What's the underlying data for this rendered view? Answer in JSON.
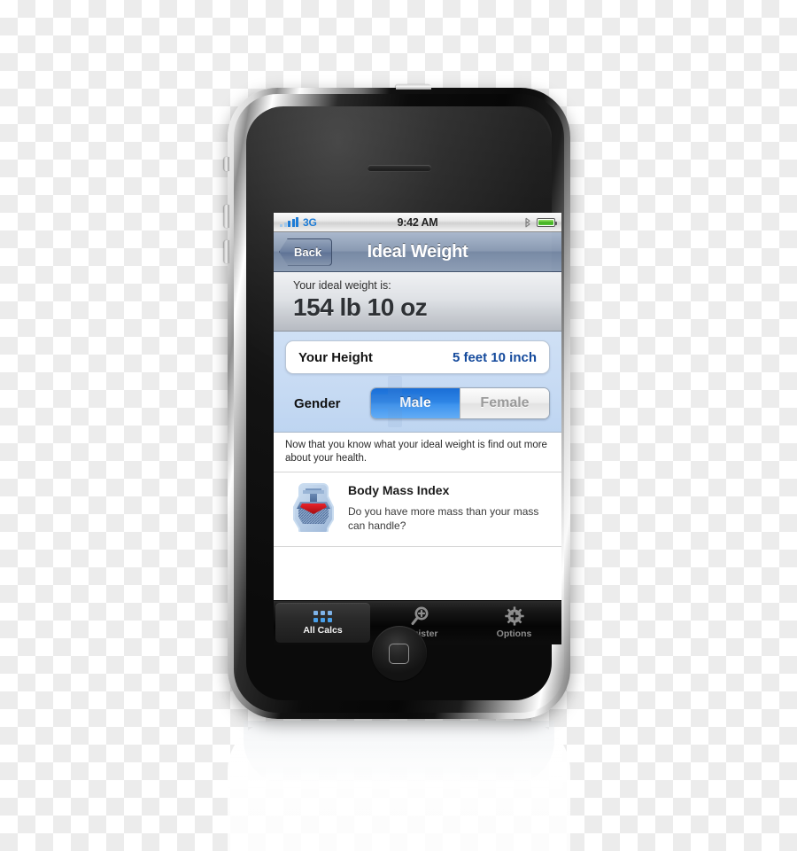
{
  "device": {
    "name": "iPhone 3G",
    "earpiece_icon": "speaker-grille-icon",
    "home_button_icon": "home-square-icon",
    "buttons": {
      "silent_switch": "silent-switch",
      "volume_up": "volume-up-button",
      "volume_down": "volume-down-button",
      "power": "power-button"
    }
  },
  "statusbar": {
    "signal_icon": "signal-bars-icon",
    "carrier": "3G",
    "time": "9:42 AM",
    "bluetooth_icon": "bluetooth-icon",
    "bluetooth_glyph": "�ILLEGAL",
    "battery_icon": "battery-icon"
  },
  "navbar": {
    "back_label": "Back",
    "title": "Ideal Weight"
  },
  "result": {
    "label": "Your ideal weight is:",
    "value": "154 lb 10 oz"
  },
  "inputs": {
    "height": {
      "label": "Your Height",
      "value": "5 feet 10 inch"
    },
    "gender": {
      "label": "Gender",
      "options": [
        "Male",
        "Female"
      ],
      "selected": "Male"
    }
  },
  "blurb": "Now that you know what your ideal weight is find out more about your health.",
  "promo": {
    "icon": "anvil-icon",
    "title": "Body Mass Index",
    "description": "Do you have more mass than your mass can handle?"
  },
  "tabbar": {
    "items": [
      {
        "label": "All Calcs",
        "icon": "grid-icon",
        "selected": true
      },
      {
        "label": "Register",
        "icon": "magnifier-plus-icon",
        "selected": false
      },
      {
        "label": "Options",
        "icon": "gear-plus-icon",
        "selected": false
      }
    ]
  },
  "colors": {
    "accent_blue": "#13499c",
    "segment_on": "#2e85e6",
    "status_carrier": "#1577d4",
    "battery_green": "#3fae1f",
    "tab_icon_blue": "#49a0ea"
  }
}
